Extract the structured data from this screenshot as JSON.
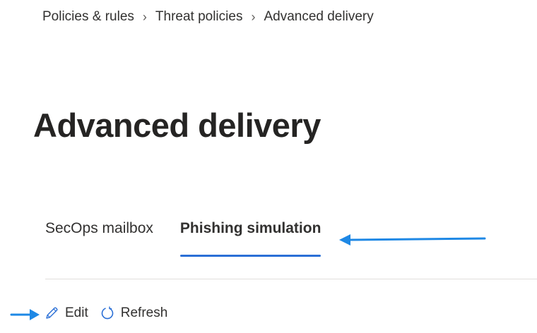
{
  "breadcrumb": {
    "items": [
      "Policies & rules",
      "Threat policies",
      "Advanced delivery"
    ],
    "separator": "›"
  },
  "page": {
    "title": "Advanced delivery"
  },
  "tabs": {
    "items": [
      {
        "label": "SecOps mailbox",
        "selected": false
      },
      {
        "label": "Phishing simulation",
        "selected": true
      }
    ]
  },
  "toolbar": {
    "edit_label": "Edit",
    "refresh_label": "Refresh",
    "edit_icon": "pencil-icon",
    "refresh_icon": "refresh-icon"
  },
  "colors": {
    "accent": "#2a6fd6",
    "annotation_arrow": "#1e88e5",
    "text": "#323130"
  }
}
